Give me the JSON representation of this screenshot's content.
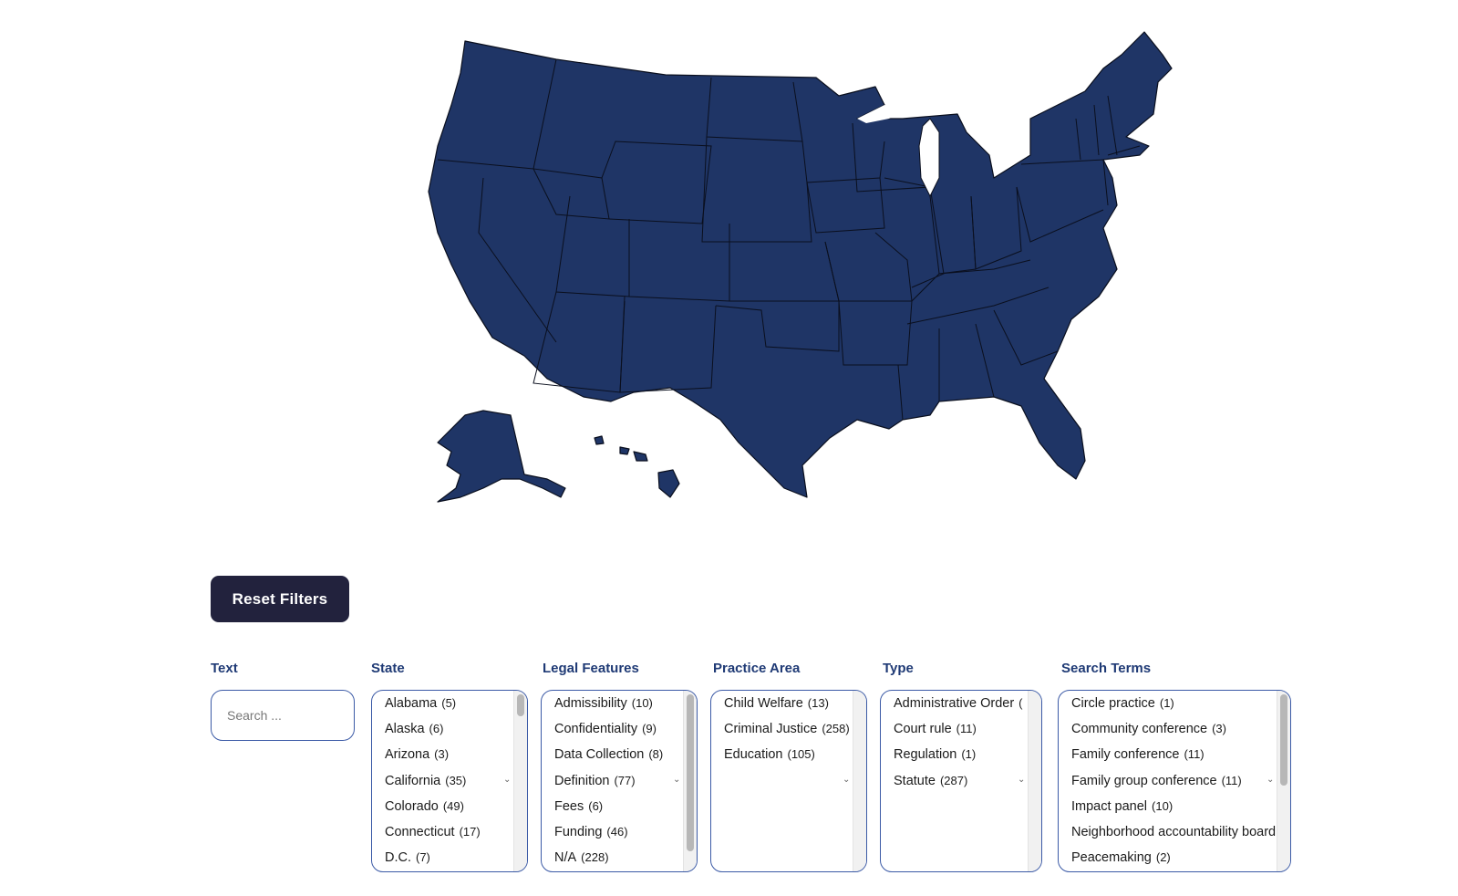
{
  "controls": {
    "reset_label": "Reset Filters"
  },
  "filters": {
    "text": {
      "label": "Text",
      "placeholder": "Search ..."
    },
    "state": {
      "label": "State",
      "items": [
        {
          "name": "Alabama",
          "count": "(5)"
        },
        {
          "name": "Alaska",
          "count": "(6)"
        },
        {
          "name": "Arizona",
          "count": "(3)"
        },
        {
          "name": "California",
          "count": "(35)"
        },
        {
          "name": "Colorado",
          "count": "(49)"
        },
        {
          "name": "Connecticut",
          "count": "(17)"
        },
        {
          "name": "D.C.",
          "count": "(7)"
        }
      ]
    },
    "legal_features": {
      "label": "Legal Features",
      "items": [
        {
          "name": "Admissibility",
          "count": "(10)"
        },
        {
          "name": "Confidentiality",
          "count": "(9)"
        },
        {
          "name": "Data Collection",
          "count": "(8)"
        },
        {
          "name": "Definition",
          "count": "(77)"
        },
        {
          "name": "Fees",
          "count": "(6)"
        },
        {
          "name": "Funding",
          "count": "(46)"
        },
        {
          "name": "N/A",
          "count": "(228)"
        }
      ]
    },
    "practice_area": {
      "label": "Practice Area",
      "items": [
        {
          "name": "Child Welfare",
          "count": "(13)"
        },
        {
          "name": "Criminal Justice",
          "count": "(258)"
        },
        {
          "name": "Education",
          "count": "(105)"
        }
      ]
    },
    "type": {
      "label": "Type",
      "items": [
        {
          "name": "Administrative Order",
          "count": "("
        },
        {
          "name": "Court rule",
          "count": "(11)"
        },
        {
          "name": "Regulation",
          "count": "(1)"
        },
        {
          "name": "Statute",
          "count": "(287)"
        }
      ]
    },
    "search_terms": {
      "label": "Search Terms",
      "items": [
        {
          "name": "Circle practice",
          "count": "(1)"
        },
        {
          "name": "Community conference",
          "count": "(3)"
        },
        {
          "name": "Family conference",
          "count": "(11)"
        },
        {
          "name": "Family group conference",
          "count": "(11)"
        },
        {
          "name": "Impact panel",
          "count": "(10)"
        },
        {
          "name": "Neighborhood accountability board",
          "count": ""
        },
        {
          "name": "Peacemaking",
          "count": "(2)"
        }
      ]
    }
  },
  "map": {
    "fill": "#1f3566",
    "stroke": "#0a0f1e"
  }
}
